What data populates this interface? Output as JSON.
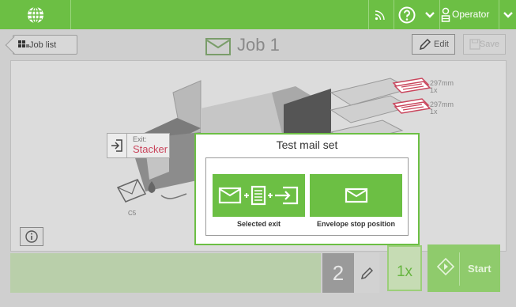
{
  "topbar": {
    "user_label": "Operator",
    "icons": [
      "globe-icon",
      "rss-icon",
      "help-icon",
      "chevron-down-icon",
      "operator-icon",
      "chevron-down-icon"
    ]
  },
  "job": {
    "back_label": "Job list",
    "title": "Job 1",
    "edit_label": "Edit",
    "save_label": "Save"
  },
  "machine": {
    "exit_label": "Exit:",
    "exit_value": "Stacker",
    "feeders": [
      {
        "size": "297mm",
        "count": "1x"
      },
      {
        "size": "297mm",
        "count": "1x"
      }
    ],
    "envelope_label": "C5"
  },
  "bottom": {
    "counter": "2",
    "batch": "1x",
    "start_label": "Start"
  },
  "popup": {
    "title": "Test mail set",
    "options": [
      {
        "label": "Selected exit"
      },
      {
        "label": "Envelope stop position"
      }
    ]
  },
  "colors": {
    "brand_green": "#6cbf44",
    "exit_red": "#c9455c"
  }
}
